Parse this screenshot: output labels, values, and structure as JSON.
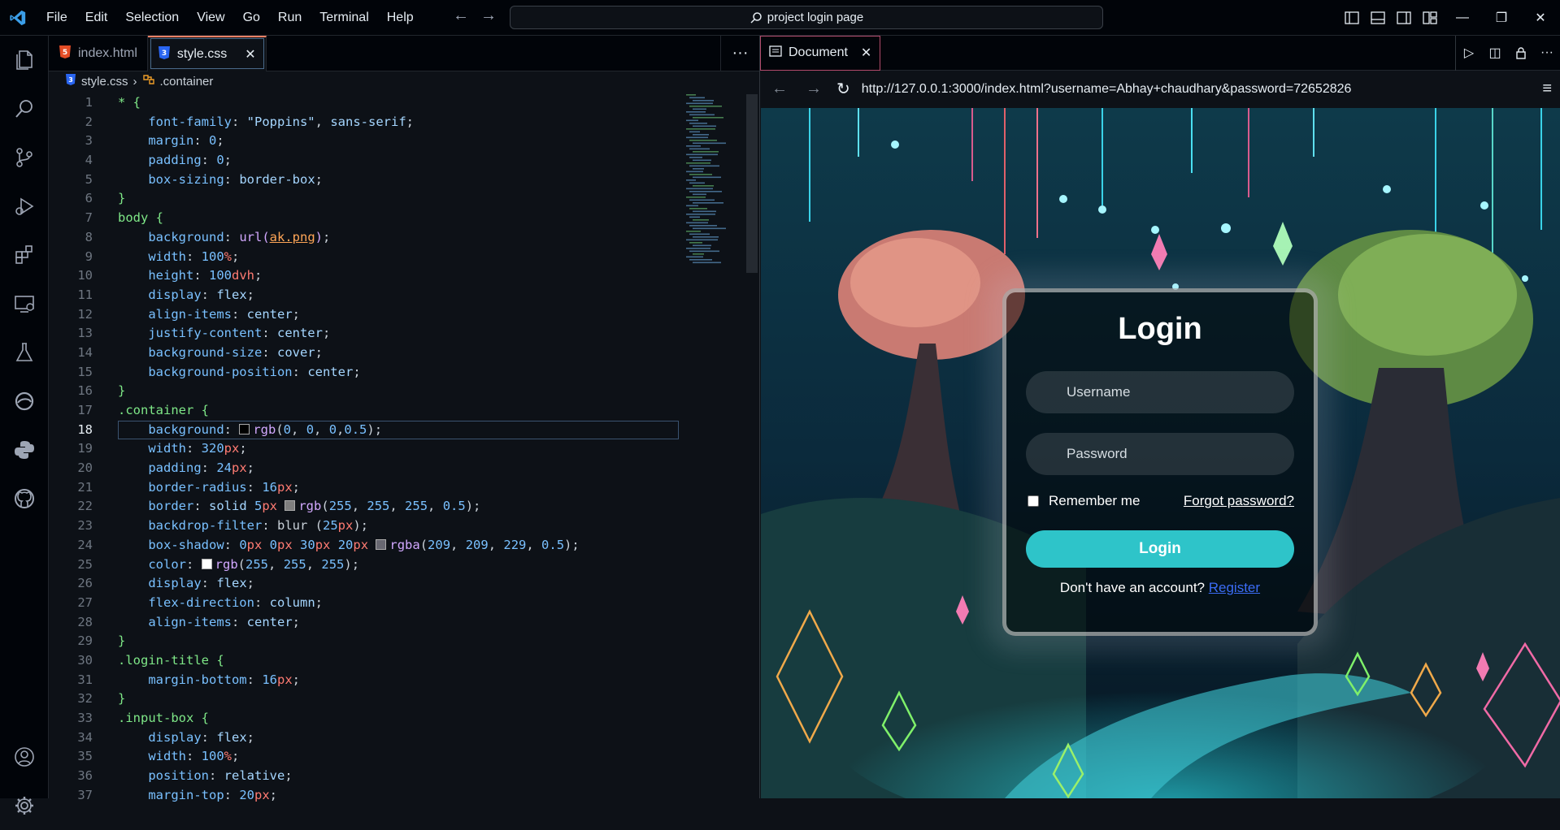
{
  "menu": [
    "File",
    "Edit",
    "Selection",
    "View",
    "Go",
    "Run",
    "Terminal",
    "Help"
  ],
  "command_center": {
    "label": "project login page"
  },
  "editor": {
    "tabs": [
      {
        "name": "index.html",
        "active": false
      },
      {
        "name": "style.css",
        "active": true
      }
    ],
    "breadcrumb": {
      "file": "style.css",
      "symbol": ".container"
    },
    "current_line": 18,
    "code": [
      [
        [
          "sel",
          "* {"
        ]
      ],
      [
        [
          "prop",
          "    font-family"
        ],
        [
          "pun",
          ": "
        ],
        [
          "str",
          "\"Poppins\""
        ],
        [
          "pun",
          ", "
        ],
        [
          "val",
          "sans-serif"
        ],
        [
          "pun",
          ";"
        ]
      ],
      [
        [
          "prop",
          "    margin"
        ],
        [
          "pun",
          ": "
        ],
        [
          "num",
          "0"
        ],
        [
          "pun",
          ";"
        ]
      ],
      [
        [
          "prop",
          "    padding"
        ],
        [
          "pun",
          ": "
        ],
        [
          "num",
          "0"
        ],
        [
          "pun",
          ";"
        ]
      ],
      [
        [
          "prop",
          "    box-sizing"
        ],
        [
          "pun",
          ": "
        ],
        [
          "val",
          "border-box"
        ],
        [
          "pun",
          ";"
        ]
      ],
      [
        [
          "sel",
          "}"
        ]
      ],
      [
        [
          "sel",
          "body {"
        ]
      ],
      [
        [
          "prop",
          "    background"
        ],
        [
          "pun",
          ": "
        ],
        [
          "fn",
          "url("
        ],
        [
          "url",
          "ak.png"
        ],
        [
          "fn",
          ")"
        ],
        [
          "pun",
          ";"
        ]
      ],
      [
        [
          "prop",
          "    width"
        ],
        [
          "pun",
          ": "
        ],
        [
          "num",
          "100"
        ],
        [
          "unit",
          "%"
        ],
        [
          "pun",
          ";"
        ]
      ],
      [
        [
          "prop",
          "    height"
        ],
        [
          "pun",
          ": "
        ],
        [
          "num",
          "100"
        ],
        [
          "unit",
          "dvh"
        ],
        [
          "pun",
          ";"
        ]
      ],
      [
        [
          "prop",
          "    display"
        ],
        [
          "pun",
          ": "
        ],
        [
          "val",
          "flex"
        ],
        [
          "pun",
          ";"
        ]
      ],
      [
        [
          "prop",
          "    align-items"
        ],
        [
          "pun",
          ": "
        ],
        [
          "val",
          "center"
        ],
        [
          "pun",
          ";"
        ]
      ],
      [
        [
          "prop",
          "    justify-content"
        ],
        [
          "pun",
          ": "
        ],
        [
          "val",
          "center"
        ],
        [
          "pun",
          ";"
        ]
      ],
      [
        [
          "prop",
          "    background-size"
        ],
        [
          "pun",
          ": "
        ],
        [
          "val",
          "cover"
        ],
        [
          "pun",
          ";"
        ]
      ],
      [
        [
          "prop",
          "    background-position"
        ],
        [
          "pun",
          ": "
        ],
        [
          "val",
          "center"
        ],
        [
          "pun",
          ";"
        ]
      ],
      [
        [
          "sel",
          "}"
        ]
      ],
      [
        [
          "sel",
          ".container {"
        ]
      ],
      [
        [
          "prop",
          "    background"
        ],
        [
          "pun",
          ": "
        ],
        [
          "sw",
          "#000000"
        ],
        [
          "fn",
          "rgb"
        ],
        [
          "pun",
          "("
        ],
        [
          "num",
          "0"
        ],
        [
          "pun",
          ", "
        ],
        [
          "num",
          "0"
        ],
        [
          "pun",
          ", "
        ],
        [
          "num",
          "0"
        ],
        [
          "pun",
          ","
        ],
        [
          "num",
          "0.5"
        ],
        [
          "pun",
          ");"
        ]
      ],
      [
        [
          "prop",
          "    width"
        ],
        [
          "pun",
          ": "
        ],
        [
          "num",
          "320"
        ],
        [
          "unit",
          "px"
        ],
        [
          "pun",
          ";"
        ]
      ],
      [
        [
          "prop",
          "    padding"
        ],
        [
          "pun",
          ": "
        ],
        [
          "num",
          "24"
        ],
        [
          "unit",
          "px"
        ],
        [
          "pun",
          ";"
        ]
      ],
      [
        [
          "prop",
          "    border-radius"
        ],
        [
          "pun",
          ": "
        ],
        [
          "num",
          "16"
        ],
        [
          "unit",
          "px"
        ],
        [
          "pun",
          ";"
        ]
      ],
      [
        [
          "prop",
          "    border"
        ],
        [
          "pun",
          ": "
        ],
        [
          "val",
          "solid "
        ],
        [
          "num",
          "5"
        ],
        [
          "unit",
          "px "
        ],
        [
          "sw",
          "#7f7f7f"
        ],
        [
          "fn",
          "rgb"
        ],
        [
          "pun",
          "("
        ],
        [
          "num",
          "255"
        ],
        [
          "pun",
          ", "
        ],
        [
          "num",
          "255"
        ],
        [
          "pun",
          ", "
        ],
        [
          "num",
          "255"
        ],
        [
          "pun",
          ", "
        ],
        [
          "num",
          "0.5"
        ],
        [
          "pun",
          ");"
        ]
      ],
      [
        [
          "prop",
          "    backdrop-filter"
        ],
        [
          "pun",
          ": "
        ],
        [
          "pun",
          "blur "
        ],
        [
          "pun",
          "("
        ],
        [
          "num",
          "25"
        ],
        [
          "unit",
          "px"
        ],
        [
          "pun",
          ");"
        ]
      ],
      [
        [
          "prop",
          "    box-shadow"
        ],
        [
          "pun",
          ": "
        ],
        [
          "num",
          "0"
        ],
        [
          "unit",
          "px "
        ],
        [
          "num",
          "0"
        ],
        [
          "unit",
          "px "
        ],
        [
          "num",
          "30"
        ],
        [
          "unit",
          "px "
        ],
        [
          "num",
          "20"
        ],
        [
          "unit",
          "px "
        ],
        [
          "sw",
          "#686872"
        ],
        [
          "fn",
          "rgba"
        ],
        [
          "pun",
          "("
        ],
        [
          "num",
          "209"
        ],
        [
          "pun",
          ", "
        ],
        [
          "num",
          "209"
        ],
        [
          "pun",
          ", "
        ],
        [
          "num",
          "229"
        ],
        [
          "pun",
          ", "
        ],
        [
          "num",
          "0.5"
        ],
        [
          "pun",
          ");"
        ]
      ],
      [
        [
          "prop",
          "    color"
        ],
        [
          "pun",
          ": "
        ],
        [
          "sw",
          "#ffffff"
        ],
        [
          "fn",
          "rgb"
        ],
        [
          "pun",
          "("
        ],
        [
          "num",
          "255"
        ],
        [
          "pun",
          ", "
        ],
        [
          "num",
          "255"
        ],
        [
          "pun",
          ", "
        ],
        [
          "num",
          "255"
        ],
        [
          "pun",
          ");"
        ]
      ],
      [
        [
          "prop",
          "    display"
        ],
        [
          "pun",
          ": "
        ],
        [
          "val",
          "flex"
        ],
        [
          "pun",
          ";"
        ]
      ],
      [
        [
          "prop",
          "    flex-direction"
        ],
        [
          "pun",
          ": "
        ],
        [
          "val",
          "column"
        ],
        [
          "pun",
          ";"
        ]
      ],
      [
        [
          "prop",
          "    align-items"
        ],
        [
          "pun",
          ": "
        ],
        [
          "val",
          "center"
        ],
        [
          "pun",
          ";"
        ]
      ],
      [
        [
          "sel",
          "}"
        ]
      ],
      [
        [
          "sel",
          ".login-title {"
        ]
      ],
      [
        [
          "prop",
          "    margin-bottom"
        ],
        [
          "pun",
          ": "
        ],
        [
          "num",
          "16"
        ],
        [
          "unit",
          "px"
        ],
        [
          "pun",
          ";"
        ]
      ],
      [
        [
          "sel",
          "}"
        ]
      ],
      [
        [
          "sel",
          ".input-box {"
        ]
      ],
      [
        [
          "prop",
          "    display"
        ],
        [
          "pun",
          ": "
        ],
        [
          "val",
          "flex"
        ],
        [
          "pun",
          ";"
        ]
      ],
      [
        [
          "prop",
          "    width"
        ],
        [
          "pun",
          ": "
        ],
        [
          "num",
          "100"
        ],
        [
          "unit",
          "%"
        ],
        [
          "pun",
          ";"
        ]
      ],
      [
        [
          "prop",
          "    position"
        ],
        [
          "pun",
          ": "
        ],
        [
          "val",
          "relative"
        ],
        [
          "pun",
          ";"
        ]
      ],
      [
        [
          "prop",
          "    margin-top"
        ],
        [
          "pun",
          ": "
        ],
        [
          "num",
          "20"
        ],
        [
          "unit",
          "px"
        ],
        [
          "pun",
          ";"
        ]
      ]
    ]
  },
  "browser": {
    "tab_title": "Document",
    "url": "http://127.0.0.1:3000/index.html?username=Abhay+chaudhary&password=72652826",
    "page": {
      "title": "Login",
      "username_placeholder": "Username",
      "password_placeholder": "Password",
      "remember_label": "Remember me",
      "forgot_link": "Forgot password?",
      "login_button": "Login",
      "register_text": "Don't have an account?",
      "register_link": "Register"
    }
  },
  "colors": {
    "accent": "#2ec4c9",
    "link": "#3b6cf5",
    "tab_border": "#f78166"
  }
}
